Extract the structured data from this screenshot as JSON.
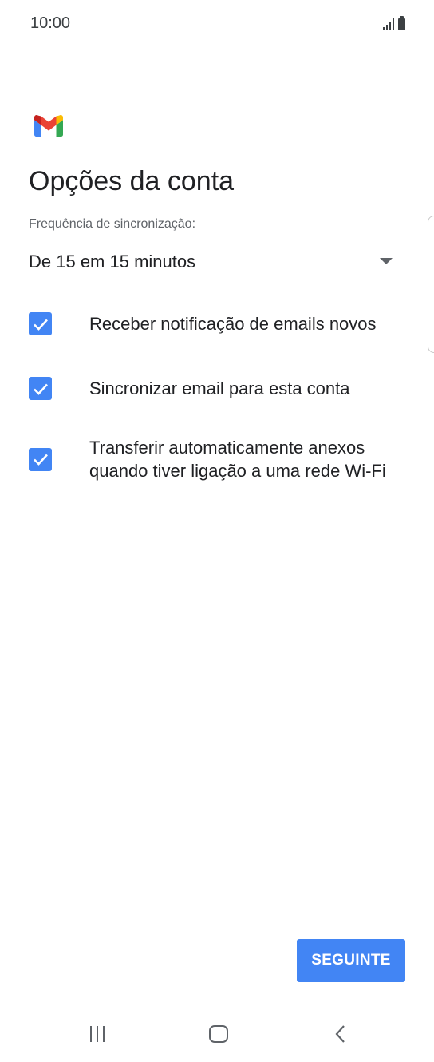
{
  "status_bar": {
    "time": "10:00"
  },
  "app": {
    "logo_icon": "gmail-logo-icon"
  },
  "page": {
    "title": "Opções da conta"
  },
  "sync": {
    "label": "Frequência de sincronização:",
    "value": "De 15 em 15 minutos",
    "icon": "dropdown-arrow-icon"
  },
  "options": [
    {
      "label": "Receber notificação de emails novos",
      "checked": true
    },
    {
      "label": "Sincronizar email para esta conta",
      "checked": true
    },
    {
      "label": "Transferir automaticamente anexos quando tiver ligação a uma rede Wi-Fi",
      "checked": true
    }
  ],
  "actions": {
    "next_label": "SEGUINTE"
  },
  "colors": {
    "accent": "#4285f4",
    "text": "#202124",
    "secondary_text": "#5f6368"
  },
  "nav": {
    "recents_icon": "recents-icon",
    "home_icon": "home-icon",
    "back_icon": "back-icon"
  }
}
